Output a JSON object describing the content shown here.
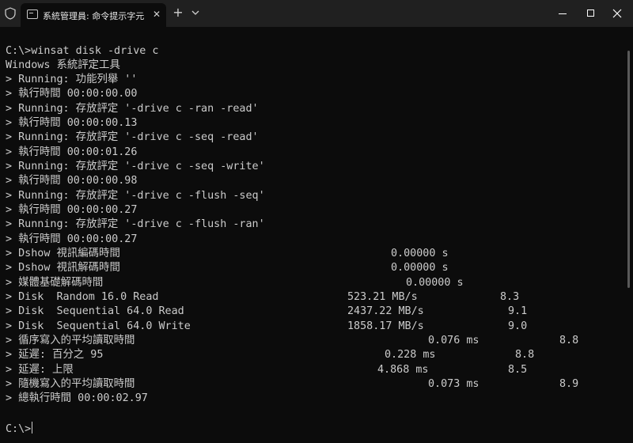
{
  "titlebar": {
    "tab_title": "系統管理員: 命令提示字元",
    "tab_close": "✕",
    "new_tab": "+",
    "icons": {
      "shield": "shield-icon",
      "terminal": "terminal-icon",
      "dropdown": "chevron-down-icon",
      "minimize": "minimize-icon",
      "maximize": "maximize-icon",
      "close": "close-icon"
    }
  },
  "terminal": {
    "lines": [
      "C:\\>winsat disk -drive c",
      "Windows 系統評定工具",
      "> Running: 功能列舉 ''",
      "> 執行時間 00:00:00.00",
      "> Running: 存放評定 '-drive c -ran -read'",
      "> 執行時間 00:00:00.13",
      "> Running: 存放評定 '-drive c -seq -read'",
      "> 執行時間 00:00:01.26",
      "> Running: 存放評定 '-drive c -seq -write'",
      "> 執行時間 00:00:00.98",
      "> Running: 存放評定 '-drive c -flush -seq'",
      "> 執行時間 00:00:00.27",
      "> Running: 存放評定 '-drive c -flush -ran'",
      "> 執行時間 00:00:00.27"
    ],
    "results": [
      {
        "label": "> Dshow 視訊編碼時間",
        "value": "0.00000 s",
        "score": ""
      },
      {
        "label": "> Dshow 視訊解碼時間",
        "value": "0.00000 s",
        "score": ""
      },
      {
        "label": "> 媒體基礎解碼時間",
        "value": "0.00000 s",
        "score": ""
      },
      {
        "label": "> Disk  Random 16.0 Read",
        "value": "523.21 MB/s",
        "score": "8.3"
      },
      {
        "label": "> Disk  Sequential 64.0 Read",
        "value": "2437.22 MB/s",
        "score": "9.1"
      },
      {
        "label": "> Disk  Sequential 64.0 Write",
        "value": "1858.17 MB/s",
        "score": "9.0"
      },
      {
        "label": "> 循序寫入的平均讀取時間",
        "value": "0.076 ms",
        "score": "8.8"
      },
      {
        "label": "> 延遲: 百分之 95",
        "value": "0.228 ms",
        "score": "8.8"
      },
      {
        "label": "> 延遲: 上限",
        "value": "4.868 ms",
        "score": "8.5"
      },
      {
        "label": "> 隨機寫入的平均讀取時間",
        "value": "0.073 ms",
        "score": "8.9"
      }
    ],
    "total": "> 總執行時間 00:00:02.97",
    "prompt": "C:\\>"
  },
  "colors": {
    "background": "#0c0c0c",
    "titlebar": "#202020",
    "text": "#cccccc"
  }
}
